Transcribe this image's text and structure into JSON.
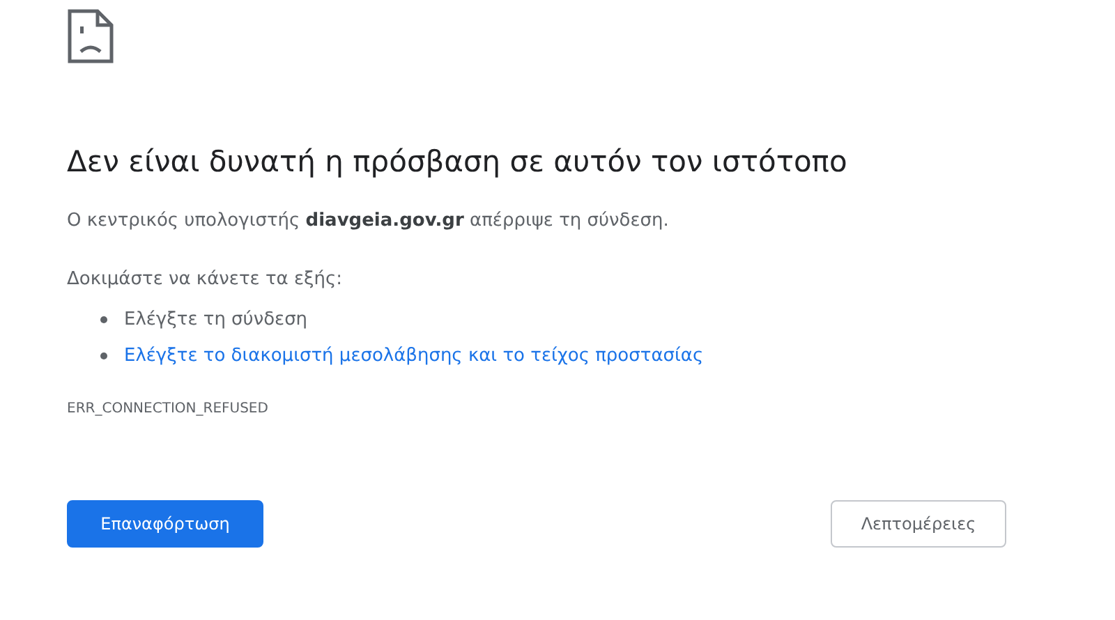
{
  "heading": "Δεν είναι δυνατή η πρόσβαση σε αυτόν τον ιστότοπο",
  "message": "Ο κεντρικός υπολογιστής **diavgeia.gov.gr** απέρριψε τη σύνδεση.",
  "suggestions_intro": "Δοκιμάστε να κάνετε τα εξής:",
  "suggestions": [
    {
      "kind": "text",
      "text": "Ελέγξτε τη σύνδεση"
    },
    {
      "kind": "link",
      "text": "Ελέγξτε το διακομιστή μεσολάβησης και το τείχος προστασίας"
    }
  ],
  "error_code": "ERR_CONNECTION_REFUSED",
  "buttons": [
    {
      "kind": "primary",
      "label": "Επαναφόρτωση"
    },
    {
      "kind": "secondary",
      "label": "Λεπτομέρειες"
    }
  ]
}
